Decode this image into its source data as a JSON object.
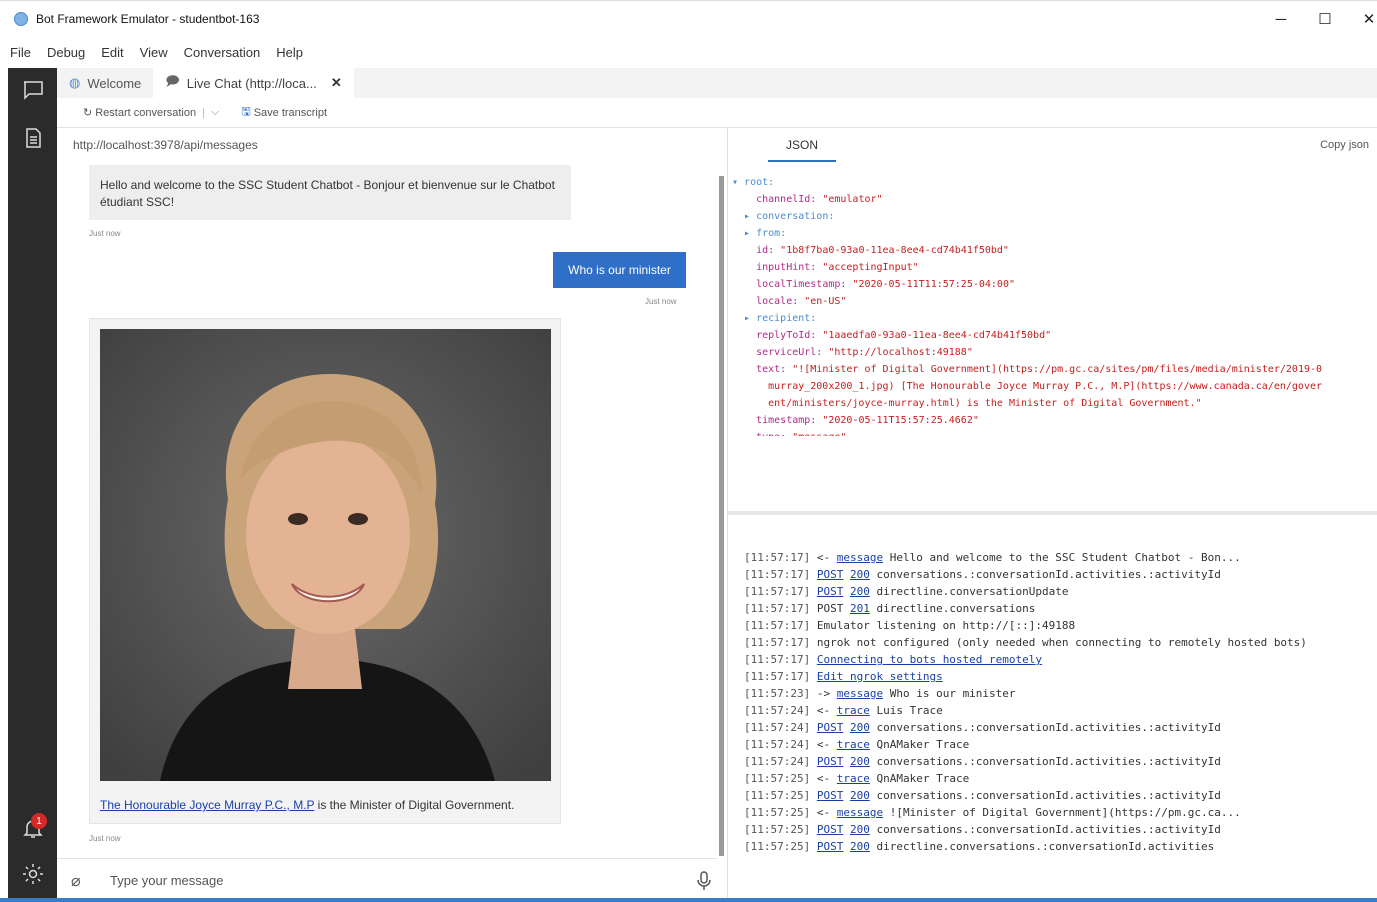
{
  "window": {
    "title": "Bot Framework Emulator - studentbot-163"
  },
  "menu": [
    "File",
    "Debug",
    "Edit",
    "View",
    "Conversation",
    "Help"
  ],
  "tabs": [
    {
      "label": "Welcome"
    },
    {
      "label": "Live Chat (http://loca..."
    }
  ],
  "toolbar": {
    "restart_label": "Restart conversation",
    "save_label": "Save transcript"
  },
  "chat": {
    "endpoint": "http://localhost:3978/api/messages",
    "bot_greeting": "Hello and welcome to the SSC Student Chatbot - Bonjour et bienvenue sur le Chatbot étudiant SSC!",
    "bot_greeting_time": "Just now",
    "user_message": "Who is our minister",
    "user_message_time": "Just now",
    "card_link": "The Honourable Joyce Murray P.C., M.P",
    "card_text": " is the Minister of Digital Government.",
    "card_time": "Just now",
    "input_placeholder": "Type your message"
  },
  "notifications": {
    "count": "1"
  },
  "inspector": {
    "tab": "JSON",
    "copy_label": "Copy json",
    "json_lines": [
      "▾ root:",
      "    channelId: \"emulator\"",
      "  ▸ conversation:",
      "  ▸ from:",
      "    id: \"1b8f7ba0-93a0-11ea-8ee4-cd74b41f50bd\"",
      "    inputHint: \"acceptingInput\"",
      "    localTimestamp: \"2020-05-11T11:57:25-04:00\"",
      "    locale: \"en-US\"",
      "  ▸ recipient:",
      "    replyToId: \"1aaedfa0-93a0-11ea-8ee4-cd74b41f50bd\"",
      "    serviceUrl: \"http://localhost:49188\"",
      "    text: \"![Minister of Digital Government](https://pm.gc.ca/sites/pm/files/media/minister/2019-0",
      "      murray_200x200_1.jpg) [The Honourable Joyce Murray P.C., M.P](https://www.canada.ca/en/gover",
      "      ent/ministers/joyce-murray.html) is the Minister of Digital Government.\"",
      "    timestamp: \"2020-05-11T15:57:25.4662\"",
      "    type: \"message\""
    ],
    "log": [
      {
        "time": "[11:57:17]",
        "parts": [
          {
            "t": " <- "
          },
          {
            "l": "message"
          },
          {
            "t": " Hello and welcome to the SSC Student Chatbot - Bon..."
          }
        ]
      },
      {
        "time": "[11:57:17]",
        "parts": [
          {
            "t": " "
          },
          {
            "l": "POST"
          },
          {
            "t": " "
          },
          {
            "l": "200"
          },
          {
            "t": " conversations.:conversationId.activities.:activityId"
          }
        ]
      },
      {
        "time": "[11:57:17]",
        "parts": [
          {
            "t": " "
          },
          {
            "l": "POST"
          },
          {
            "t": " "
          },
          {
            "l": "200"
          },
          {
            "t": " directline.conversationUpdate"
          }
        ]
      },
      {
        "time": "[11:57:17]",
        "parts": [
          {
            "t": " POST "
          },
          {
            "l": "201"
          },
          {
            "t": " directline.conversations"
          }
        ]
      },
      {
        "time": "[11:57:17]",
        "parts": [
          {
            "t": " Emulator listening on http://[::]:49188"
          }
        ]
      },
      {
        "time": "[11:57:17]",
        "parts": [
          {
            "t": " ngrok not configured (only needed when connecting to remotely hosted bots)"
          }
        ]
      },
      {
        "time": "[11:57:17]",
        "parts": [
          {
            "t": " "
          },
          {
            "l": "Connecting to bots hosted remotely"
          }
        ]
      },
      {
        "time": "[11:57:17]",
        "parts": [
          {
            "t": " "
          },
          {
            "l": "Edit ngrok settings"
          }
        ]
      },
      {
        "time": "[11:57:23]",
        "parts": [
          {
            "t": " -> "
          },
          {
            "l": "message"
          },
          {
            "t": " Who is our minister"
          }
        ]
      },
      {
        "time": "[11:57:24]",
        "parts": [
          {
            "t": " <- "
          },
          {
            "l": "trace"
          },
          {
            "t": " Luis Trace"
          }
        ]
      },
      {
        "time": "[11:57:24]",
        "parts": [
          {
            "t": " "
          },
          {
            "l": "POST"
          },
          {
            "t": " "
          },
          {
            "l": "200"
          },
          {
            "t": " conversations.:conversationId.activities.:activityId"
          }
        ]
      },
      {
        "time": "[11:57:24]",
        "parts": [
          {
            "t": " <- "
          },
          {
            "l": "trace"
          },
          {
            "t": " QnAMaker Trace"
          }
        ]
      },
      {
        "time": "[11:57:24]",
        "parts": [
          {
            "t": " "
          },
          {
            "l": "POST"
          },
          {
            "t": " "
          },
          {
            "l": "200"
          },
          {
            "t": " conversations.:conversationId.activities.:activityId"
          }
        ]
      },
      {
        "time": "[11:57:25]",
        "parts": [
          {
            "t": " <- "
          },
          {
            "l": "trace"
          },
          {
            "t": " QnAMaker Trace"
          }
        ]
      },
      {
        "time": "[11:57:25]",
        "parts": [
          {
            "t": " "
          },
          {
            "l": "POST"
          },
          {
            "t": " "
          },
          {
            "l": "200"
          },
          {
            "t": " conversations.:conversationId.activities.:activityId"
          }
        ]
      },
      {
        "time": "[11:57:25]",
        "parts": [
          {
            "t": " <- "
          },
          {
            "l": "message"
          },
          {
            "t": " ![Minister of Digital Government](https://pm.gc.ca..."
          }
        ]
      },
      {
        "time": "[11:57:25]",
        "parts": [
          {
            "t": " "
          },
          {
            "l": "POST"
          },
          {
            "t": " "
          },
          {
            "l": "200"
          },
          {
            "t": " conversations.:conversationId.activities.:activityId"
          }
        ]
      },
      {
        "time": "[11:57:25]",
        "parts": [
          {
            "t": " "
          },
          {
            "l": "POST"
          },
          {
            "t": " "
          },
          {
            "l": "200"
          },
          {
            "t": " directline.conversations.:conversationId.activities"
          }
        ]
      }
    ]
  },
  "colors": {
    "accent": "#2f6fc7",
    "sidebar": "#2b2b2b",
    "link": "#1a3fa8",
    "badge": "#d72828"
  },
  "icons": [
    "chat-icon",
    "document-icon",
    "bell-icon",
    "gear-icon",
    "paperclip-icon",
    "microphone-icon",
    "restart-icon",
    "save-icon",
    "globe-icon"
  ]
}
